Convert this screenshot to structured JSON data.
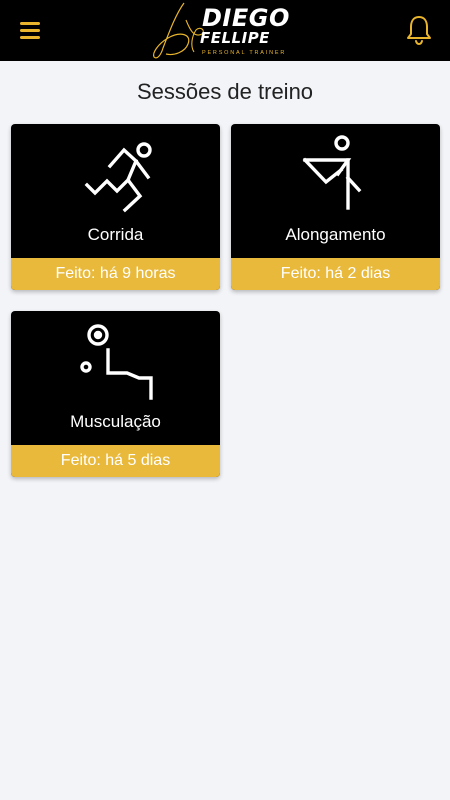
{
  "colors": {
    "accent": "#e9b93c",
    "topbar": "#000000",
    "background": "#f2f4f8"
  },
  "header": {
    "logo": {
      "line1": "DIEGO",
      "line2": "FELLIPE",
      "tagline": "PERSONAL TRAINER"
    },
    "menu_icon": "hamburger-menu-icon",
    "notification_icon": "bell-icon"
  },
  "page": {
    "title": "Sessões de treino"
  },
  "sessions": [
    {
      "name": "Corrida",
      "status": "Feito: há 9 horas",
      "icon": "running-icon"
    },
    {
      "name": "Alongamento",
      "status": "Feito: há 2 dias",
      "icon": "stretching-icon"
    },
    {
      "name": "Musculação",
      "status": "Feito: há 5 dias",
      "icon": "weightlifting-icon"
    }
  ]
}
